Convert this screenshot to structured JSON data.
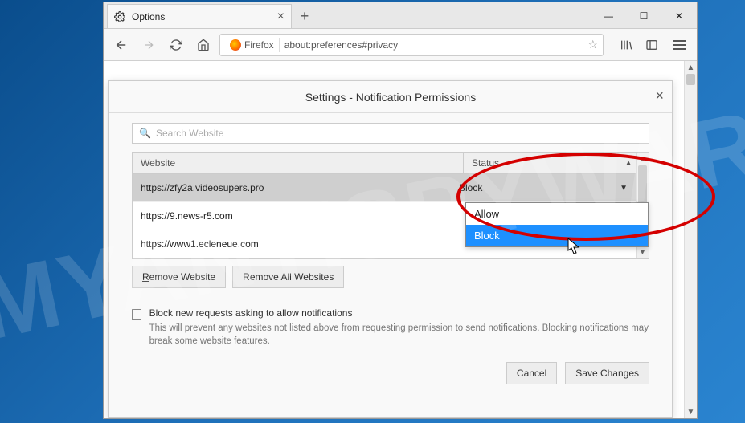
{
  "browser": {
    "tab_title": "Options",
    "firefox_label": "Firefox",
    "url": "about:preferences#privacy"
  },
  "dialog": {
    "title": "Settings - Notification Permissions",
    "search_placeholder": "Search Website",
    "columns": {
      "website": "Website",
      "status": "Status"
    },
    "rows": [
      {
        "site": "https://zfy2a.videosupers.pro",
        "status": "Block",
        "selected": true
      },
      {
        "site": "https://9.news-r5.com",
        "status": ""
      },
      {
        "site": "https://www1.ecleneue.com",
        "status": ""
      }
    ],
    "dropdown_options": [
      "Allow",
      "Block"
    ],
    "dropdown_selected": "Block",
    "buttons": {
      "remove_website": "Remove Website",
      "remove_all": "Remove All Websites",
      "cancel": "Cancel",
      "save": "Save Changes"
    },
    "checkbox_label": "Block new requests asking to allow notifications",
    "checkbox_desc": "This will prevent any websites not listed above from requesting permission to send notifications. Blocking notifications may break some website features."
  },
  "watermark": "MYANTISPYWARE.COM"
}
